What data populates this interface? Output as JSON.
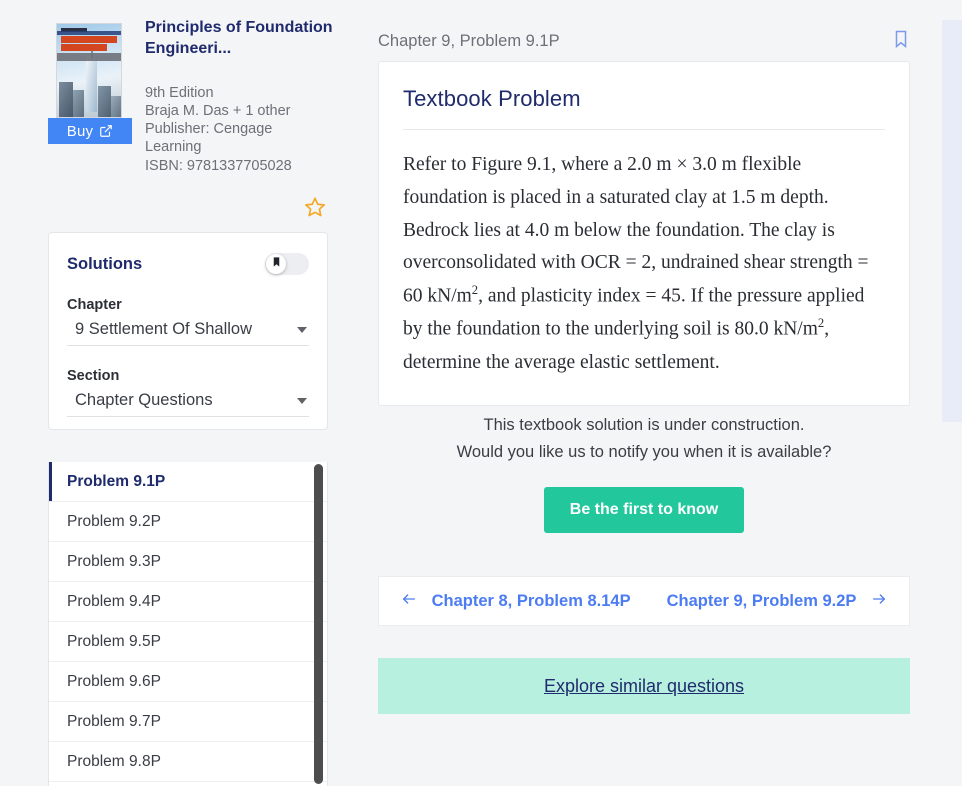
{
  "book": {
    "title": "Principles of Foundation Engineeri...",
    "edition": "9th Edition",
    "authors": "Braja M. Das + 1 other",
    "publisher": "Publisher: Cengage Learning",
    "isbn": "ISBN: 9781337705028",
    "buy_label": "Buy",
    "buy_icon": "external-link-icon",
    "favorite_icon": "star-outline-icon",
    "cover_title_line1": "PRINCIPLES OF",
    "cover_title_line2": "FOUNDATION",
    "cover_title_line3": "ENGINEERING"
  },
  "solutions": {
    "title": "Solutions",
    "bookmark_toggle_icon": "bookmark-icon",
    "chapter_label": "Chapter",
    "chapter_value": "9 Settlement Of Shallow",
    "section_label": "Section",
    "section_value": "Chapter Questions",
    "dropdown_icon": "chevron-down-icon",
    "problems": [
      {
        "label": "Problem 9.1P",
        "active": true
      },
      {
        "label": "Problem 9.2P",
        "active": false
      },
      {
        "label": "Problem 9.3P",
        "active": false
      },
      {
        "label": "Problem 9.4P",
        "active": false
      },
      {
        "label": "Problem 9.5P",
        "active": false
      },
      {
        "label": "Problem 9.6P",
        "active": false
      },
      {
        "label": "Problem 9.7P",
        "active": false
      },
      {
        "label": "Problem 9.8P",
        "active": false
      }
    ]
  },
  "main": {
    "breadcrumb": "Chapter 9, Problem 9.1P",
    "bookmark_icon": "bookmark-outline-icon",
    "card_title": "Textbook Problem",
    "problem_text_parts": {
      "p1": "Refer to Figure 9.1, where a 2.0 m × 3.0 m flexible foundation is placed in a saturated clay at 1.5 m depth. Bedrock lies at 4.0 m below the foundation. The clay is overconsolidated with OCR = 2, undrained shear strength = 60 kN/m",
      "sup1": "2",
      "p2": ", and plasticity index = 45. If the pressure applied by the foundation to the underlying soil is 80.0 kN/m",
      "sup2": "2",
      "p3": ", determine the average elastic settlement."
    },
    "under_construction_line1": "This textbook solution is under construction.",
    "under_construction_line2": "Would you like us to notify you when it is available?",
    "cta_label": "Be the first to know",
    "prev_label": "Chapter 8, Problem 8.14P",
    "next_label": "Chapter 9, Problem 9.2P",
    "prev_icon": "arrow-left-icon",
    "next_icon": "arrow-right-icon",
    "explore_label": "Explore similar questions"
  },
  "colors": {
    "brand_navy": "#1f2b6c",
    "buy_blue": "#4285f4",
    "cta_green": "#22c89c",
    "link_blue": "#4c7cf3",
    "explore_bg": "#b8f0e0",
    "star_gold": "#f5a623",
    "page_bg": "#f4f5f7",
    "right_panel": "#e8ebf8"
  }
}
